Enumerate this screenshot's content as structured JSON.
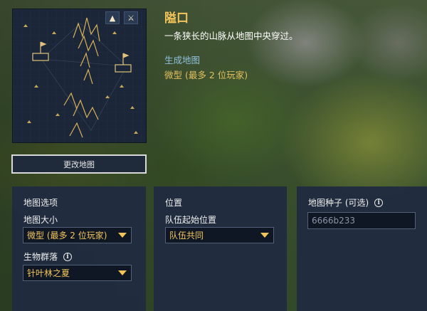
{
  "map": {
    "name": "隘口",
    "description": "一条狭长的山脉从地图中央穿过。",
    "generate_link": "生成地图",
    "size_summary": "微型 (最多 2 位玩家)",
    "change_button": "更改地图",
    "badges": [
      "mountain-icon",
      "team-icon"
    ]
  },
  "panels": {
    "map_options": {
      "title": "地图选项",
      "size_label": "地图大小",
      "size_value": "微型 (最多 2 位玩家)",
      "biome_label": "生物群落",
      "biome_value": "针叶林之夏"
    },
    "location": {
      "title": "位置",
      "team_start_label": "队伍起始位置",
      "team_start_value": "队伍共同"
    },
    "seed": {
      "label": "地图种子 (可选)",
      "placeholder": "6666b233"
    }
  },
  "colors": {
    "accent_gold": "#f3c45a",
    "link_blue": "#8fc0dd",
    "panel_bg": "#202c40",
    "map_bg": "#1b2638"
  }
}
